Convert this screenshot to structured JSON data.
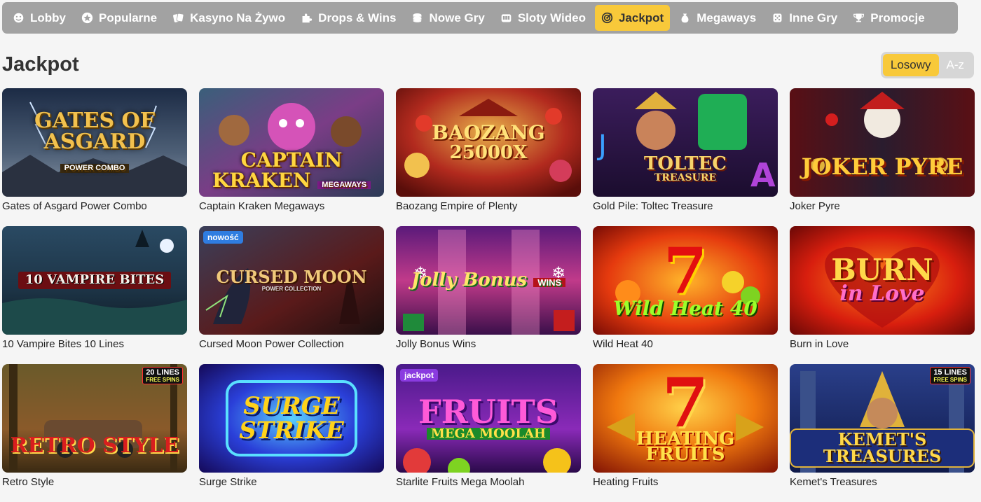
{
  "nav": {
    "items": [
      {
        "label": "Lobby",
        "icon": "smile-icon",
        "active": false
      },
      {
        "label": "Popularne",
        "icon": "star-icon",
        "active": false
      },
      {
        "label": "Kasyno Na Żywo",
        "icon": "cards-icon",
        "active": false
      },
      {
        "label": "Drops & Wins",
        "icon": "puzzle-icon",
        "active": false
      },
      {
        "label": "Nowe Gry",
        "icon": "coins-icon",
        "active": false
      },
      {
        "label": "Sloty Wideo",
        "icon": "slot-machine-icon",
        "active": false
      },
      {
        "label": "Jackpot",
        "icon": "target-icon",
        "active": true
      },
      {
        "label": "Megaways",
        "icon": "money-bag-icon",
        "active": false
      },
      {
        "label": "Inne Gry",
        "icon": "dice-icon",
        "active": false
      },
      {
        "label": "Promocje",
        "icon": "trophy-icon",
        "active": false
      }
    ]
  },
  "section": {
    "title": "Jackpot",
    "sort": {
      "options": [
        "Losowy",
        "A-z"
      ],
      "selected": "Losowy"
    }
  },
  "colors": {
    "accent": "#f8c93a",
    "nav_bg": "#a2a2a2",
    "page_bg": "#f5f5f5"
  },
  "games": [
    {
      "name": "Gates of Asgard Power Combo",
      "logo": "GATES OF ASGARD",
      "sub": "POWER COMBO"
    },
    {
      "name": "Captain Kraken Megaways",
      "logo": "CAPTAIN KRAKEN",
      "sub": "MEGAWAYS"
    },
    {
      "name": "Baozang Empire of Plenty",
      "logo": "BAOZANG",
      "sub": "25000X"
    },
    {
      "name": "Gold Pile: Toltec Treasure",
      "logo": "TOLTEC",
      "sub": "TREASURE"
    },
    {
      "name": "Joker Pyre",
      "logo": "JOKER PYRE",
      "sub": ""
    },
    {
      "name": "10 Vampire Bites 10 Lines",
      "logo": "10 VAMPIRE BITES",
      "sub": ""
    },
    {
      "name": "Cursed Moon Power Collection",
      "logo": "CURSED MOON",
      "sub": "POWER COLLECTION",
      "badge": "nowość"
    },
    {
      "name": "Jolly Bonus Wins",
      "logo": "Jolly Bonus",
      "sub": "WINS"
    },
    {
      "name": "Wild Heat 40",
      "logo": "7",
      "sub": "Wild Heat 40"
    },
    {
      "name": "Burn in Love",
      "logo": "BURN",
      "sub": "in Love"
    },
    {
      "name": "Retro Style",
      "logo": "RETRO STYLE",
      "sub": "",
      "lines": "20 LINES",
      "lines_sub": "FREE SPINS"
    },
    {
      "name": "Surge Strike",
      "logo": "SURGE STRIKE",
      "sub": ""
    },
    {
      "name": "Starlite Fruits Mega Moolah",
      "logo": "FRUITS",
      "sub": "MEGA MOOLAH",
      "badge": "jackpot"
    },
    {
      "name": "Heating Fruits",
      "logo": "7",
      "sub": "HEATING FRUITS"
    },
    {
      "name": "Kemet's Treasures",
      "logo": "KEMET'S TREASURES",
      "sub": "",
      "lines": "15 LINES",
      "lines_sub": "FREE SPINS"
    }
  ]
}
